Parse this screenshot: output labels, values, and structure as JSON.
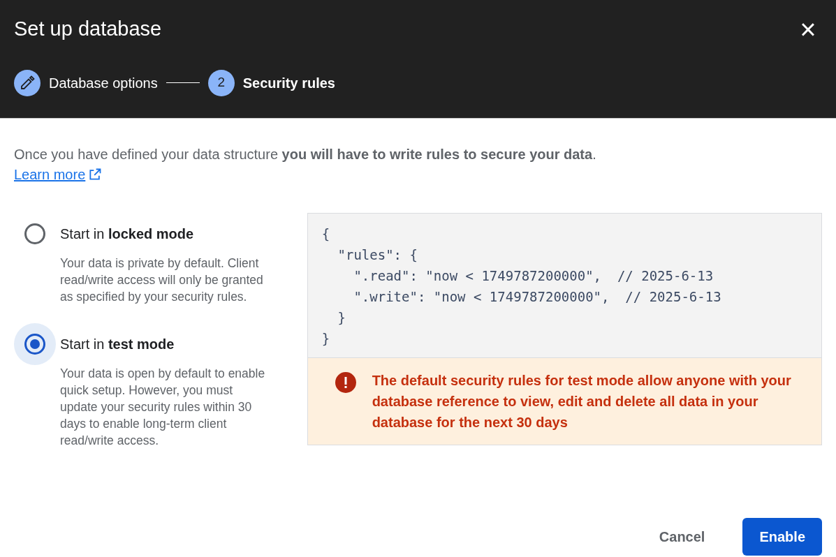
{
  "dialog": {
    "title": "Set up database",
    "close": "×"
  },
  "steps": [
    {
      "kind": "edit",
      "label": "Database options",
      "selected": false
    },
    {
      "kind": "number",
      "number": "2",
      "label": "Security rules",
      "selected": true
    }
  ],
  "intro": {
    "text": "Once you have defined your data structure **you will have to write rules to secure your data**.",
    "link": "Learn more"
  },
  "options": [
    {
      "title": "Start in **locked mode**",
      "description": "Your data is private by default. Client read/write access will only be granted as specified by your security rules.",
      "selected": false
    },
    {
      "title": "Start in **test mode**",
      "description": "Your data is open by default to enable quick setup. However, you must update your security rules within 30 days to enable long-term client read/write access.",
      "selected": true
    }
  ],
  "code": [
    "{",
    "  \"rules\": {",
    "    \".read\": \"now < 1749787200000\",  // 2025-6-13",
    "    \".write\": \"now < 1749787200000\",  // 2025-6-13",
    "  }",
    "}"
  ],
  "warning": "The default security rules for test mode allow anyone with your database reference to view, edit and delete all data in your database for the next 30 days",
  "buttons": [
    {
      "kind": "text",
      "label": "Cancel"
    },
    {
      "kind": "primary",
      "label": "Enable"
    }
  ]
}
